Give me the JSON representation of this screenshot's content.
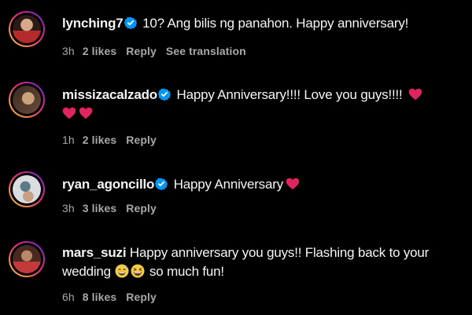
{
  "comments": [
    {
      "username": "lynching7",
      "verified": true,
      "text": "10? Ang bilis ng panahon. Happy anniversary!",
      "time": "3h",
      "likes": "2 likes",
      "reply": "Reply",
      "see_translation": "See translation",
      "avatar_colors": [
        "#2b1a16",
        "#b52a2a"
      ]
    },
    {
      "username": "missizacalzado",
      "verified": true,
      "text": "Happy Anniversary!!!! Love you guys!!!!",
      "time": "1h",
      "likes": "2 likes",
      "reply": "Reply",
      "avatar_colors": [
        "#3b2a22",
        "#c8a27a"
      ]
    },
    {
      "username": "ryan_agoncillo",
      "verified": true,
      "text": "Happy Anniversary",
      "time": "3h",
      "likes": "3 likes",
      "reply": "Reply",
      "avatar_colors": [
        "#d9dde0",
        "#5a7a88"
      ]
    },
    {
      "username": "mars_suzi",
      "verified": false,
      "text_line1": "Happy anniversary you guys!! Flashing back to your",
      "text_line2a": "wedding",
      "text_line2b": "so much fun!",
      "time": "6h",
      "likes": "8 likes",
      "reply": "Reply",
      "avatar_colors": [
        "#4a2a20",
        "#c43a3a"
      ]
    }
  ],
  "icons": {
    "verified": "verified-badge-icon",
    "heart": "red-heart-icon",
    "emoji_grin": "grinning-sweat-emoji-icon",
    "emoji_squint": "grinning-squinting-emoji-icon"
  },
  "colors": {
    "background": "#000000",
    "text": "#f5f5f5",
    "secondary": "#a8a8a8",
    "verified": "#0095f6",
    "heart": "#e0245e"
  }
}
